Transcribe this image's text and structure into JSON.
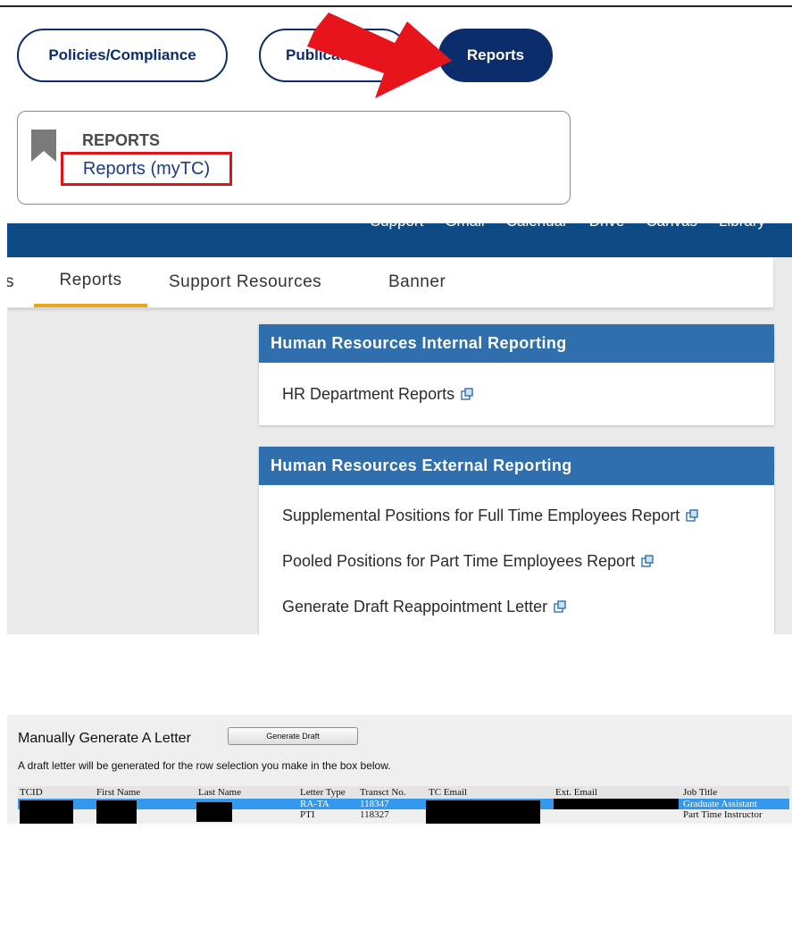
{
  "top_nav": {
    "policies_label": "Policies/Compliance",
    "publications_label": "Publications",
    "reports_label": "Reports"
  },
  "reports_card": {
    "heading": "REPORTS",
    "link_label": "Reports (myTC)"
  },
  "portal": {
    "top_links": [
      "Support",
      "Gmail",
      "Calendar",
      "Drive",
      "Canvas",
      "Library"
    ],
    "tabs": [
      "s",
      "Reports",
      "Support Resources",
      "Banner"
    ],
    "active_tab": "Reports",
    "internal": {
      "title": "Human Resources Internal Reporting",
      "links": [
        "HR Department Reports"
      ]
    },
    "external": {
      "title": "Human Resources External Reporting",
      "links": [
        "Supplemental Positions for Full Time Employees Report",
        "Pooled Positions for Part Time Employees Report",
        "Generate Draft Reappointment Letter"
      ]
    }
  },
  "letter_tool": {
    "title": "Manually Generate A Letter",
    "button_label": "Generate Draft",
    "description": "A draft letter will be generated for the row selection you make in the box below.",
    "columns": [
      "TCID",
      "First Name",
      "Last Name",
      "Letter Type",
      "Transct No.",
      "TC Email",
      "Ext. Email",
      "Job Title"
    ],
    "rows": [
      {
        "letter_type": "RA-TA",
        "transct_no": "118347",
        "job_title": "Graduate Assistant",
        "selected": true
      },
      {
        "letter_type": "PTI",
        "transct_no": "118327",
        "job_title": "Part Time Instructor",
        "selected": false
      }
    ]
  },
  "colors": {
    "navy": "#0c2d6b",
    "arrow_red": "#e8141b",
    "card_header_blue": "#2f6fad",
    "tab_underline": "#e8a620",
    "selected_row": "#3399ee"
  }
}
